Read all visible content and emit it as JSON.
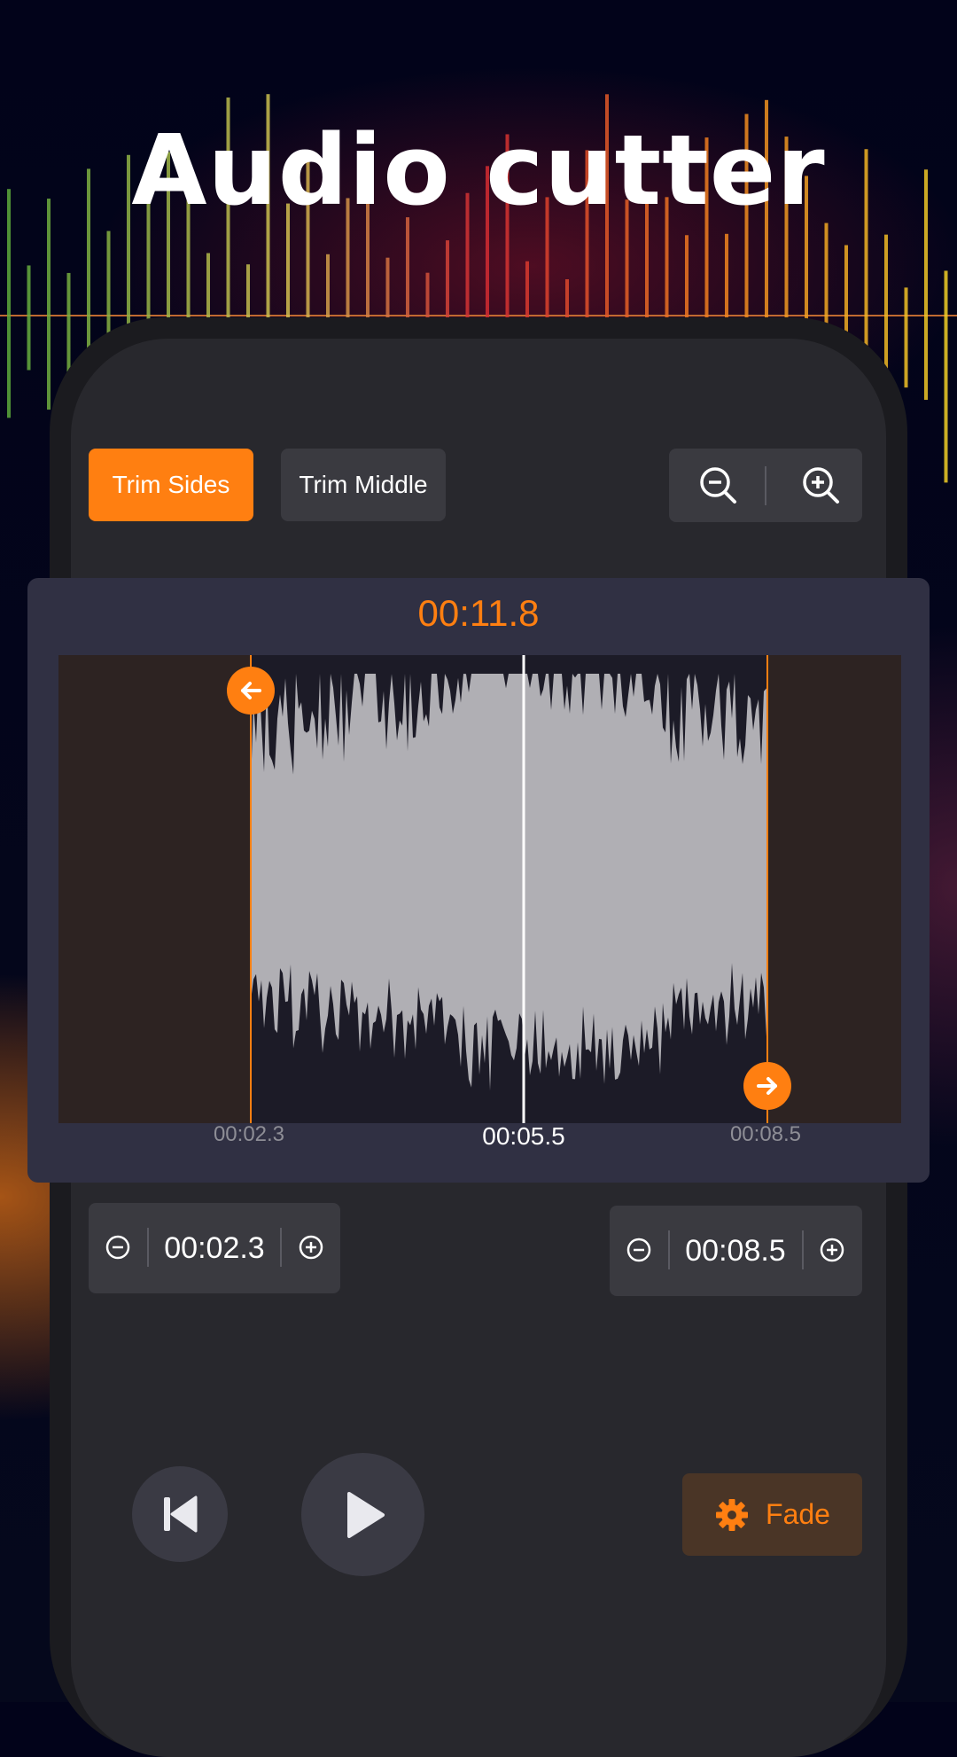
{
  "title": "Audio cutter",
  "toolbar": {
    "trim_sides": "Trim Sides",
    "trim_middle": "Trim Middle",
    "zoom_out_icon": "zoom-out-icon",
    "zoom_in_icon": "zoom-in-icon"
  },
  "editor": {
    "duration": "00:11.8",
    "start_tick": "00:02.3",
    "playhead_tick": "00:05.5",
    "end_tick": "00:08.5"
  },
  "start_control": {
    "value": "00:02.3"
  },
  "end_control": {
    "value": "00:08.5"
  },
  "playback": {
    "previous_icon": "skip-previous-icon",
    "play_icon": "play-icon",
    "fade_label": "Fade",
    "fade_icon": "gear-icon"
  },
  "colors": {
    "accent": "#ff7f11",
    "panel": "#303043",
    "waveform": "#b0afb4"
  }
}
